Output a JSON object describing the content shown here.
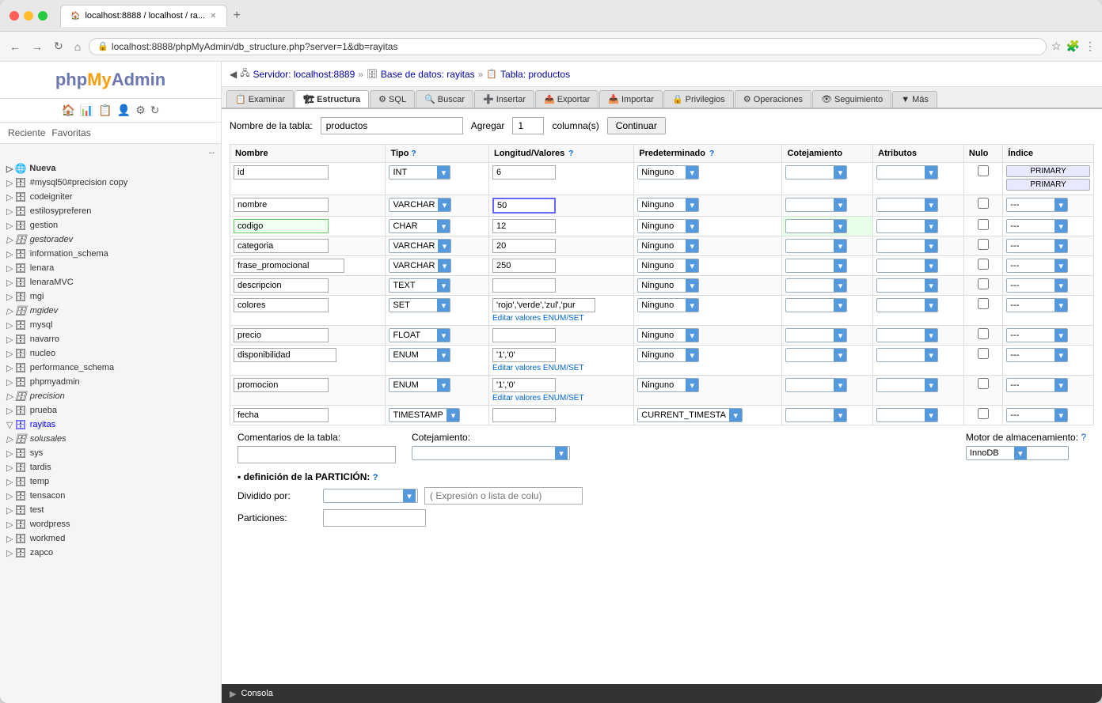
{
  "browser": {
    "url": "localhost:8888/phpMyAdmin/db_structure.php?server=1&db=rayitas",
    "tab_title": "localhost:8888 / localhost / ra...",
    "tab_icon": "🏠"
  },
  "breadcrumb": {
    "server": "Servidor: localhost:8889",
    "db": "Base de datos: rayitas",
    "table": "Tabla: productos"
  },
  "nav_tabs": [
    {
      "id": "examinar",
      "label": "Examinar",
      "icon": "📋"
    },
    {
      "id": "estructura",
      "label": "Estructura",
      "icon": "🏗"
    },
    {
      "id": "sql",
      "label": "SQL",
      "icon": "⚙"
    },
    {
      "id": "buscar",
      "label": "Buscar",
      "icon": "🔍"
    },
    {
      "id": "insertar",
      "label": "Insertar",
      "icon": "➕"
    },
    {
      "id": "exportar",
      "label": "Exportar",
      "icon": "📤"
    },
    {
      "id": "importar",
      "label": "Importar",
      "icon": "📥"
    },
    {
      "id": "privilegios",
      "label": "Privilegios",
      "icon": "🔒"
    },
    {
      "id": "operaciones",
      "label": "Operaciones",
      "icon": "⚙"
    },
    {
      "id": "seguimiento",
      "label": "Seguimiento",
      "icon": "👁"
    },
    {
      "id": "mas",
      "label": "Más",
      "icon": "▼"
    }
  ],
  "table_form": {
    "nombre_label": "Nombre de la tabla:",
    "nombre_value": "productos",
    "agregar_label": "Agregar",
    "agregar_value": "1",
    "columnas_label": "columna(s)",
    "continuar_label": "Continuar"
  },
  "table_columns": {
    "headers": [
      "Nombre",
      "Tipo",
      "Longitud/Valores",
      "Predeterminado",
      "Cotejamiento",
      "Atributos",
      "Nulo",
      "Índice"
    ],
    "rows": [
      {
        "name": "id",
        "type": "INT",
        "length": "6",
        "default": "Ninguno",
        "collation": "",
        "attributes": "",
        "null": false,
        "index": "PRIMARY",
        "index2": "PRIMARY"
      },
      {
        "name": "nombre",
        "type": "VARCHAR",
        "length": "50",
        "default": "Ninguno",
        "collation": "",
        "attributes": "",
        "null": false,
        "index": "---"
      },
      {
        "name": "codigo",
        "type": "CHAR",
        "length": "12",
        "default": "Ninguno",
        "collation": "",
        "attributes": "",
        "null": false,
        "index": "---",
        "highlight_name": true,
        "highlight_collation": true
      },
      {
        "name": "categoria",
        "type": "VARCHAR",
        "length": "20",
        "default": "Ninguno",
        "collation": "",
        "attributes": "",
        "null": false,
        "index": "---"
      },
      {
        "name": "frase_promocional",
        "type": "VARCHAR",
        "length": "250",
        "default": "Ninguno",
        "collation": "",
        "attributes": "",
        "null": false,
        "index": "---"
      },
      {
        "name": "descripcion",
        "type": "TEXT",
        "length": "",
        "default": "Ninguno",
        "collation": "",
        "attributes": "",
        "null": false,
        "index": "---"
      },
      {
        "name": "colores",
        "type": "SET",
        "length": "'rojo','verde','zul','pur",
        "default": "Ninguno",
        "collation": "",
        "attributes": "",
        "null": false,
        "index": "---",
        "has_enum_edit": true,
        "enum_label": "Editar valores ENUM/SET"
      },
      {
        "name": "precio",
        "type": "FLOAT",
        "length": "",
        "default": "Ninguno",
        "collation": "",
        "attributes": "",
        "null": false,
        "index": "---"
      },
      {
        "name": "disponibilidad",
        "type": "ENUM",
        "length": "'1','0'",
        "default": "Ninguno",
        "collation": "",
        "attributes": "",
        "null": false,
        "index": "---",
        "has_enum_edit": true,
        "enum_label": "Editar valores ENUM/SET"
      },
      {
        "name": "promocion",
        "type": "ENUM",
        "length": "'1','0'",
        "default": "Ninguno",
        "collation": "",
        "attributes": "",
        "null": false,
        "index": "---",
        "has_enum_edit": true,
        "enum_label": "Editar valores ENUM/SET"
      },
      {
        "name": "fecha",
        "type": "TIMESTAMP",
        "length": "",
        "default": "CURRENT_TIMESTA",
        "collation": "",
        "attributes": "",
        "null": false,
        "index": "---"
      }
    ]
  },
  "bottom": {
    "comentarios_label": "Comentarios de la tabla:",
    "cotejamiento_label": "Cotejamiento:",
    "motor_label": "Motor de almacenamiento:",
    "motor_value": "InnoDB",
    "partition_title": "definición de la PARTICIÓN:",
    "dividido_label": "Dividido por:",
    "particiones_label": "Particiones:",
    "partition_expr_placeholder": "( Expresión o lista de colu)"
  },
  "sidebar": {
    "recent_label": "Reciente",
    "favorites_label": "Favoritas",
    "nueva_label": "Nueva",
    "databases": [
      {
        "name": "#mysql50#precision copy",
        "icon": "🗄"
      },
      {
        "name": "codeigniter",
        "icon": "🗄"
      },
      {
        "name": "estilosypreferen",
        "icon": "🗄"
      },
      {
        "name": "gestion",
        "icon": "🗄"
      },
      {
        "name": "gestoradev",
        "icon": "🗄",
        "italic": true
      },
      {
        "name": "information_schema",
        "icon": "🗄"
      },
      {
        "name": "lenara",
        "icon": "🗄"
      },
      {
        "name": "lenaraMVC",
        "icon": "🗄"
      },
      {
        "name": "mgi",
        "icon": "🗄"
      },
      {
        "name": "mgidev",
        "icon": "🗄",
        "italic": true
      },
      {
        "name": "mysql",
        "icon": "🗄"
      },
      {
        "name": "navarro",
        "icon": "🗄"
      },
      {
        "name": "nucleo",
        "icon": "🗄"
      },
      {
        "name": "performance_schema",
        "icon": "🗄"
      },
      {
        "name": "phpmyadmin",
        "icon": "🗄"
      },
      {
        "name": "precision",
        "icon": "🗄",
        "italic": true
      },
      {
        "name": "prueba",
        "icon": "🗄"
      },
      {
        "name": "rayitas",
        "icon": "🗄",
        "active": true
      },
      {
        "name": "solusales",
        "icon": "🗄",
        "italic": true
      },
      {
        "name": "sys",
        "icon": "🗄"
      },
      {
        "name": "tardis",
        "icon": "🗄"
      },
      {
        "name": "temp",
        "icon": "🗄"
      },
      {
        "name": "tensacon",
        "icon": "🗄"
      },
      {
        "name": "test",
        "icon": "🗄"
      },
      {
        "name": "wordpress",
        "icon": "🗄"
      },
      {
        "name": "workmed",
        "icon": "🗄"
      },
      {
        "name": "zapco",
        "icon": "🗄"
      }
    ]
  },
  "console": {
    "label": "Consola"
  }
}
